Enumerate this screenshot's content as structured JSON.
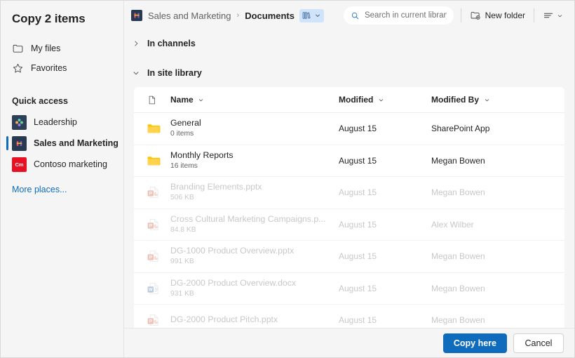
{
  "dialog": {
    "title": "Copy 2 items"
  },
  "sidebar": {
    "nav": [
      {
        "label": "My files",
        "icon": "folder-icon",
        "selected": false
      },
      {
        "label": "Favorites",
        "icon": "star-icon",
        "selected": false
      }
    ],
    "quick_access_label": "Quick access",
    "quick_access": [
      {
        "label": "Leadership",
        "tile": "leadership-tile",
        "initials": "",
        "selected": false
      },
      {
        "label": "Sales and Marketing",
        "tile": "sales-tile",
        "initials": "",
        "selected": true
      },
      {
        "label": "Contoso marketing",
        "tile": "contoso-tile",
        "initials": "Cm",
        "selected": false
      }
    ],
    "more_places_label": "More places..."
  },
  "toolbar": {
    "breadcrumb_site": "Sales and Marketing",
    "breadcrumb_separator": "›",
    "breadcrumb_current": "Documents",
    "library_picker_icon": "library-icon",
    "library_picker_chevron": "chevron-down-icon",
    "search_placeholder": "Search in current library",
    "search_value": "",
    "new_folder_label": "New folder",
    "view_options_icon": "view-options-icon"
  },
  "sections": {
    "channels": {
      "label": "In channels",
      "expanded": false,
      "chevron": "chevron-right-icon"
    },
    "site_library": {
      "label": "In site library",
      "expanded": true,
      "chevron": "chevron-down-icon"
    }
  },
  "grid": {
    "columns": {
      "icon": "file-type-icon",
      "name": "Name",
      "modified": "Modified",
      "modified_by": "Modified By"
    },
    "rows": [
      {
        "icon": "folder",
        "name": "General",
        "meta": "0 items",
        "modified": "August 15",
        "modified_by": "SharePoint App",
        "disabled": false
      },
      {
        "icon": "folder",
        "name": "Monthly Reports",
        "meta": "16 items",
        "modified": "August 15",
        "modified_by": "Megan Bowen",
        "disabled": false
      },
      {
        "icon": "pptx",
        "name": "Branding Elements.pptx",
        "meta": "506 KB",
        "modified": "August 15",
        "modified_by": "Megan Bowen",
        "disabled": true
      },
      {
        "icon": "pptx",
        "name": "Cross Cultural Marketing Campaigns.p...",
        "meta": "84.8 KB",
        "modified": "August 15",
        "modified_by": "Alex Wilber",
        "disabled": true
      },
      {
        "icon": "pptx",
        "name": "DG-1000 Product Overview.pptx",
        "meta": "991 KB",
        "modified": "August 15",
        "modified_by": "Megan Bowen",
        "disabled": true
      },
      {
        "icon": "docx",
        "name": "DG-2000 Product Overview.docx",
        "meta": "931 KB",
        "modified": "August 15",
        "modified_by": "Megan Bowen",
        "disabled": true
      },
      {
        "icon": "pptx",
        "name": "DG-2000 Product Pitch.pptx",
        "meta": "",
        "modified": "August 15",
        "modified_by": "Megan Bowen",
        "disabled": true
      }
    ]
  },
  "footer": {
    "primary_label": "Copy here",
    "cancel_label": "Cancel"
  },
  "colors": {
    "brand_blue": "#0f6cbd",
    "folder_yellow": "#ffc300",
    "powerpoint_orange": "#d24726",
    "word_blue": "#2b579a",
    "contoso_red": "#e81123",
    "text_primary": "#242424",
    "text_secondary": "#616161",
    "disabled_text": "#c8c8c8",
    "library_pill_bg": "#cfe4fa"
  }
}
